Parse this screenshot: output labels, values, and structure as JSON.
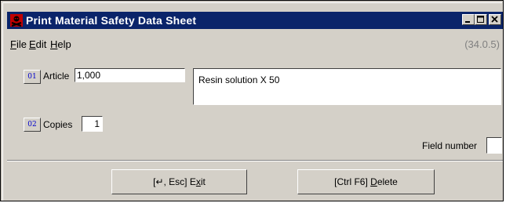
{
  "window": {
    "title": "Print Material Safety Data Sheet",
    "version": "(34.0.5)",
    "title_bar_color": "#0a246a"
  },
  "menu": {
    "items": [
      {
        "label": "File",
        "accel": "F",
        "rest": "ile"
      },
      {
        "label": "Edit",
        "accel": "E",
        "rest": "dit"
      },
      {
        "label": "Help",
        "accel": "H",
        "rest": "elp"
      }
    ]
  },
  "form": {
    "article": {
      "field_no": "01",
      "label": "Article",
      "value": "1,000"
    },
    "description": {
      "value": "Resin solution X 50"
    },
    "copies": {
      "field_no": "02",
      "label": "Copies",
      "value": "1"
    },
    "field_number": {
      "label": "Field number",
      "value": ""
    }
  },
  "buttons": {
    "exit": {
      "pre": "[↵, Esc] E",
      "accel": "x",
      "post": "it"
    },
    "delete": {
      "pre": "[Ctrl F6] ",
      "accel": "D",
      "post": "elete"
    }
  },
  "icons": {
    "app": "hazard-app-icon",
    "minimize": "minimize-icon",
    "maximize": "maximize-icon",
    "close": "close-icon"
  }
}
